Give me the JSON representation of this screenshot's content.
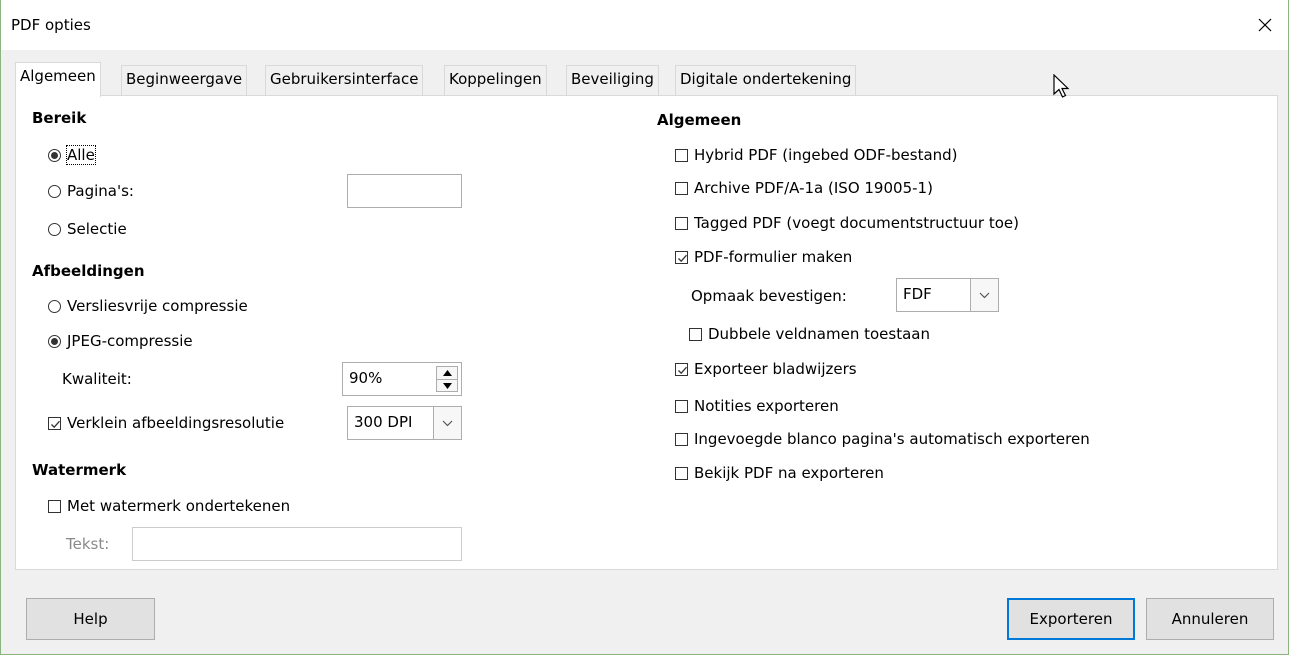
{
  "window": {
    "title": "PDF opties"
  },
  "tabs": [
    {
      "label": "Algemeen",
      "active": true
    },
    {
      "label": "Beginweergave"
    },
    {
      "label": "Gebruikersinterface"
    },
    {
      "label": "Koppelingen"
    },
    {
      "label": "Beveiliging"
    },
    {
      "label": "Digitale ondertekening"
    }
  ],
  "left": {
    "range": {
      "heading": "Bereik",
      "all": "Alle",
      "pages": "Pagina's:",
      "pages_value": "",
      "selection": "Selectie",
      "selected": "all"
    },
    "images": {
      "heading": "Afbeeldingen",
      "lossless": "Versliesvrije compressie",
      "jpeg": "JPEG-compressie",
      "selected": "jpeg",
      "quality_label": "Kwaliteit:",
      "quality_value": "90%",
      "reduce_label": "Verklein afbeeldingsresolutie",
      "reduce_checked": true,
      "resolution_value": "300 DPI"
    },
    "watermark": {
      "heading": "Watermerk",
      "sign_label": "Met watermerk ondertekenen",
      "sign_checked": false,
      "text_label": "Tekst:",
      "text_value": ""
    }
  },
  "right": {
    "heading": "Algemeen",
    "hybrid": {
      "label": "Hybrid PDF (ingebed ODF-bestand)",
      "checked": false
    },
    "archive": {
      "label": "Archive PDF/A-1a (ISO 19005-1)",
      "checked": false
    },
    "tagged": {
      "label": "Tagged PDF (voegt documentstructuur toe)",
      "checked": false
    },
    "form": {
      "label": "PDF-formulier maken",
      "checked": true
    },
    "format_label": "Opmaak bevestigen:",
    "format_value": "FDF",
    "double_fields": {
      "label": "Dubbele veldnamen toestaan",
      "checked": false
    },
    "bookmarks": {
      "label": "Exporteer bladwijzers",
      "checked": true
    },
    "notes": {
      "label": "Notities exporteren",
      "checked": false
    },
    "blank_pages": {
      "label": "Ingevoegde blanco pagina's automatisch exporteren",
      "checked": false
    },
    "view_after": {
      "label": "Bekijk PDF na exporteren",
      "checked": false
    }
  },
  "buttons": {
    "help": "Help",
    "export": "Exporteren",
    "cancel": "Annuleren"
  }
}
